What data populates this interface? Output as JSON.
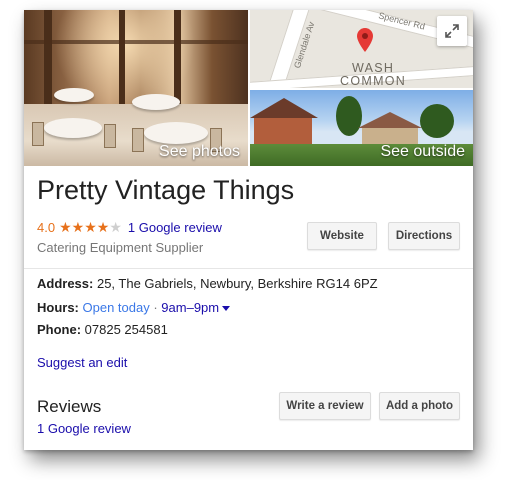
{
  "photos": {
    "see_photos_label": "See photos",
    "see_outside_label": "See outside"
  },
  "map": {
    "road_labels": [
      "Glendale Av",
      "Spencer Rd"
    ],
    "town_label_line1": "WASH",
    "town_label_line2": "COMMON"
  },
  "business": {
    "name": "Pretty Vintage Things",
    "rating_value": "4.0",
    "rating_stars": 4,
    "rating_max": 5,
    "review_count_link": "1 Google review",
    "category": "Catering Equipment Supplier"
  },
  "actions": {
    "website_label": "Website",
    "directions_label": "Directions"
  },
  "details": {
    "address_label": "Address:",
    "address_value": " 25, The Gabriels, Newbury, Berkshire RG14 6PZ",
    "hours_label": "Hours:",
    "hours_status": "Open today",
    "hours_separator": " · ",
    "hours_range": "9am–9pm",
    "phone_label": "Phone:",
    "phone_value": " 07825 254581"
  },
  "suggest_edit_link": "Suggest an edit",
  "reviews": {
    "heading": "Reviews",
    "count_link": "1 Google review",
    "write_review_label": "Write a review",
    "add_photo_label": "Add a photo"
  },
  "colors": {
    "star": "#e7711b",
    "link": "#1a0dab",
    "open_status": "#3b78e7",
    "pin": "#e53935"
  }
}
